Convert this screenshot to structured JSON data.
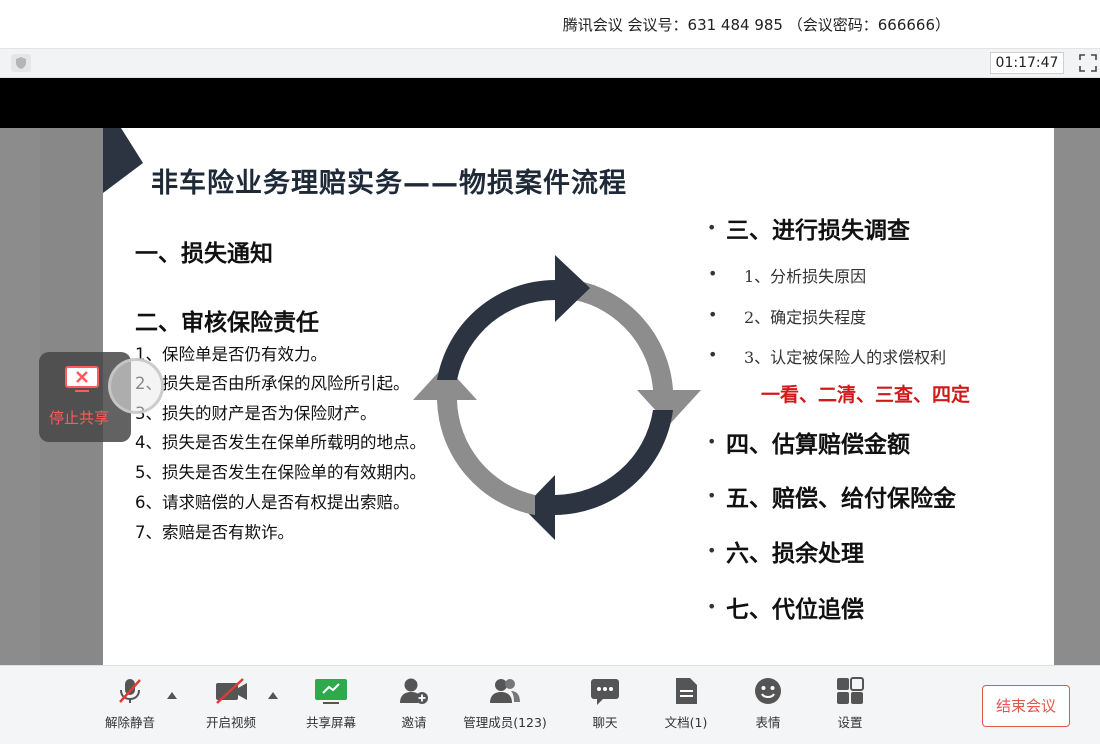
{
  "meeting": {
    "info": "腾讯会议 会议号：631 484 985 （会议密码：666666）",
    "timer": "01:17:47"
  },
  "slide": {
    "title": "非车险业务理赔实务——物损案件流程",
    "left": {
      "h1": "一、损失通知",
      "h2": "二、审核保险责任",
      "items": [
        "1、保险单是否仍有效力。",
        "2、损失是否由所承保的风险所引起。",
        "3、损失的财产是否为保险财产。",
        "4、损失是否发生在保单所载明的地点。",
        "5、损失是否发生在保险单的有效期内。",
        "6、请求赔偿的人是否有权提出索赔。",
        "7、索赔是否有欺诈。"
      ]
    },
    "right": {
      "h3": "三、进行损失调查",
      "sub": [
        "1、分析损失原因",
        "2、确定损失程度",
        "3、认定被保险人的求偿权利"
      ],
      "highlight": "一看、二清、三查、四定",
      "h4": "四、估算赔偿金额",
      "h5": "五、赔偿、给付保险金",
      "h6": "六、损余处理",
      "h7": "七、代位追偿"
    },
    "colors": {
      "dark": "#2b3440",
      "gray": "#8d8d8d",
      "red": "#d01a1a"
    }
  },
  "overlay": {
    "stop_share": "停止共享"
  },
  "toolbar": {
    "mute": "解除静音",
    "video": "开启视频",
    "share": "共享屏幕",
    "invite": "邀请",
    "members": "管理成员(123)",
    "chat": "聊天",
    "docs": "文档(1)",
    "emoji": "表情",
    "settings": "设置",
    "end": "结束会议"
  }
}
